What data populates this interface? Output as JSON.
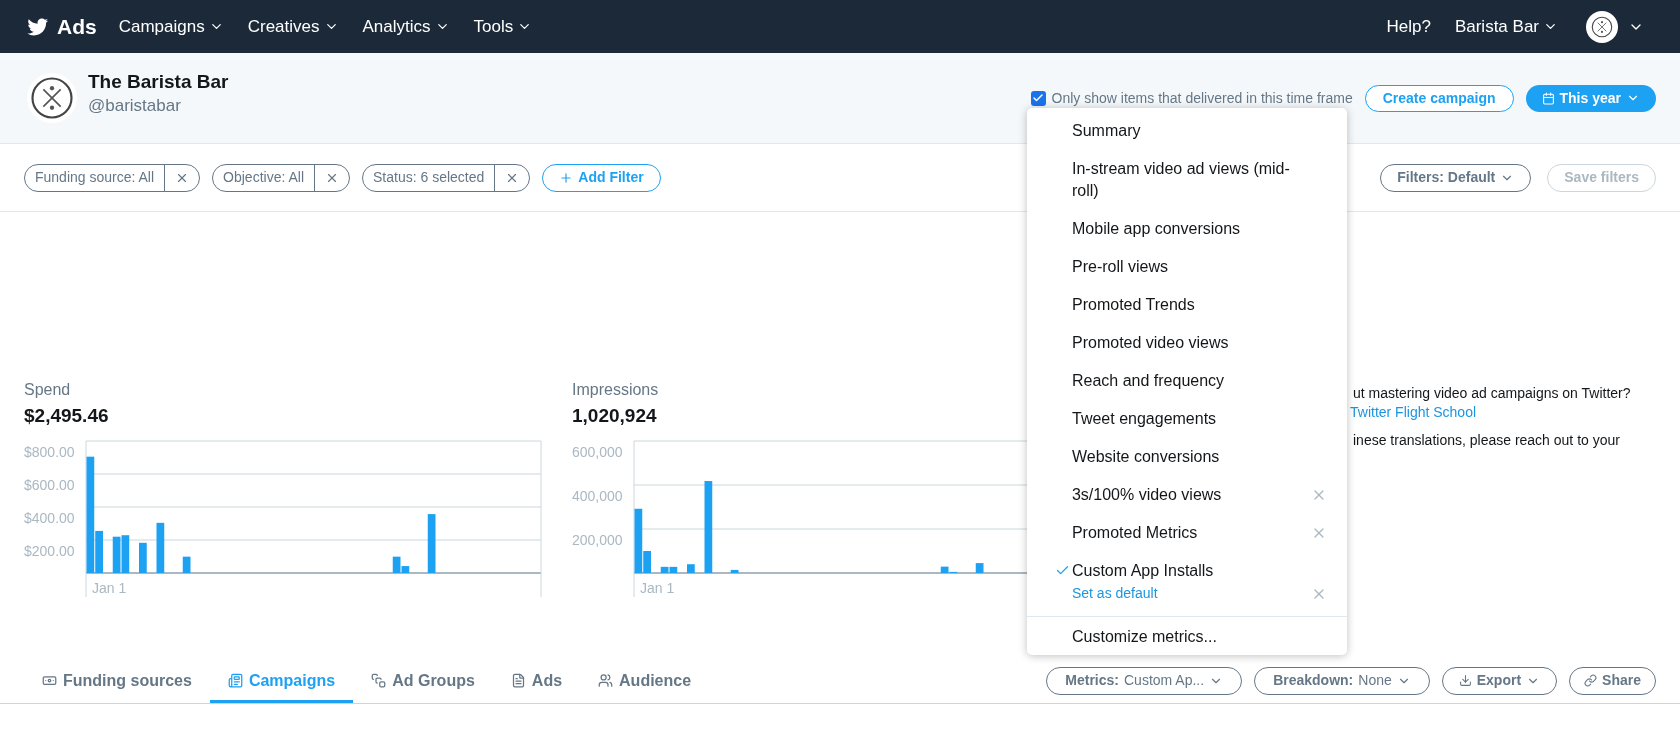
{
  "nav": {
    "brand": "Ads",
    "menus": [
      {
        "label": "Campaigns"
      },
      {
        "label": "Creatives"
      },
      {
        "label": "Analytics"
      },
      {
        "label": "Tools"
      }
    ],
    "help": "Help?",
    "account": "Barista Bar"
  },
  "account": {
    "name": "The Barista Bar",
    "handle": "@baristabar"
  },
  "delivered_filter": {
    "label": "Only show items that delivered in this time frame",
    "checked": true
  },
  "create_campaign": "Create campaign",
  "date_range": "This year",
  "filters": [
    {
      "label": "Funding source: All"
    },
    {
      "label": "Objective: All"
    },
    {
      "label": "Status: 6 selected"
    }
  ],
  "add_filter": "Add Filter",
  "filters_preset": "Filters: Default",
  "save_filters": {
    "label": "Save filters",
    "disabled": true
  },
  "charts": [
    {
      "title": "Spend",
      "total": "$2,495.46",
      "chart_data": {
        "type": "bar",
        "grid": true,
        "ylim": [
          0,
          800
        ],
        "yticks": [
          {
            "value": 200,
            "label": "$200.00"
          },
          {
            "value": 400,
            "label": "$400.00"
          },
          {
            "value": 600,
            "label": "$600.00"
          },
          {
            "value": 800,
            "label": "$800.00"
          }
        ],
        "annotations": [
          "Jan 1"
        ],
        "series": [
          {
            "color": "#1da1f2",
            "values": [
              705,
              255,
              null,
              220,
              229,
              null,
              183,
              null,
              304,
              null,
              null,
              99,
              null,
              null,
              null,
              null,
              null,
              null,
              null,
              null,
              null,
              null,
              null,
              null,
              null,
              null,
              null,
              null,
              null,
              null,
              null,
              null,
              null,
              null,
              null,
              99,
              42,
              null,
              null,
              357,
              null,
              null,
              null,
              null,
              null,
              null,
              null,
              null,
              null,
              null,
              null,
              null
            ]
          }
        ]
      }
    },
    {
      "title": "Impressions",
      "total": "1,020,924",
      "chart_data": {
        "type": "bar",
        "grid": true,
        "ylim": [
          0,
          600000
        ],
        "yticks": [
          {
            "value": 200000,
            "label": "200,000"
          },
          {
            "value": 400000,
            "label": "400,000"
          },
          {
            "value": 600000,
            "label": "600,000"
          }
        ],
        "annotations": [
          "Jan 1"
        ],
        "series": [
          {
            "color": "#1da1f2",
            "values": [
              292000,
              100000,
              null,
              28000,
              28000,
              null,
              40000,
              null,
              418000,
              null,
              null,
              14000,
              null,
              null,
              null,
              null,
              null,
              null,
              null,
              null,
              null,
              null,
              null,
              null,
              null,
              null,
              null,
              null,
              null,
              null,
              null,
              null,
              null,
              null,
              null,
              29000,
              5000,
              null,
              null,
              45000,
              null,
              null,
              null,
              null,
              null,
              null,
              null,
              null,
              null,
              null,
              null,
              null
            ]
          }
        ]
      }
    }
  ],
  "info_panel": {
    "line_1": "ut mastering video ad campaigns on Twitter?",
    "link": "Twitter Flight School",
    "line_3": "inese translations, please reach out to your"
  },
  "metrics_menu": {
    "items": [
      {
        "label": "Summary",
        "selected": false,
        "removable": false
      },
      {
        "label": "In-stream video ad views (mid-roll)",
        "selected": false,
        "removable": false
      },
      {
        "label": "Mobile app conversions",
        "selected": false,
        "removable": false
      },
      {
        "label": "Pre-roll views",
        "selected": false,
        "removable": false
      },
      {
        "label": "Promoted Trends",
        "selected": false,
        "removable": false
      },
      {
        "label": "Promoted video views",
        "selected": false,
        "removable": false
      },
      {
        "label": "Reach and frequency",
        "selected": false,
        "removable": false
      },
      {
        "label": "Tweet engagements",
        "selected": false,
        "removable": false
      },
      {
        "label": "Website conversions",
        "selected": false,
        "removable": false
      },
      {
        "label": "3s/100% video views",
        "selected": false,
        "removable": true
      },
      {
        "label": "Promoted Metrics",
        "selected": false,
        "removable": true
      },
      {
        "label": "Custom App Installs",
        "selected": true,
        "removable": true,
        "action": "Set as default"
      }
    ],
    "footer": "Customize metrics..."
  },
  "tabs": [
    {
      "label": "Funding sources",
      "selected": false
    },
    {
      "label": "Campaigns",
      "selected": true
    },
    {
      "label": "Ad Groups",
      "selected": false
    },
    {
      "label": "Ads",
      "selected": false
    },
    {
      "label": "Audience",
      "selected": false
    }
  ],
  "toolbar": [
    {
      "kind": "select",
      "label": "Metrics:",
      "value": "Custom Ap..."
    },
    {
      "kind": "select",
      "label": "Breakdown:",
      "value": "None"
    },
    {
      "kind": "export",
      "label": "Export"
    },
    {
      "kind": "share",
      "label": "Share"
    }
  ]
}
